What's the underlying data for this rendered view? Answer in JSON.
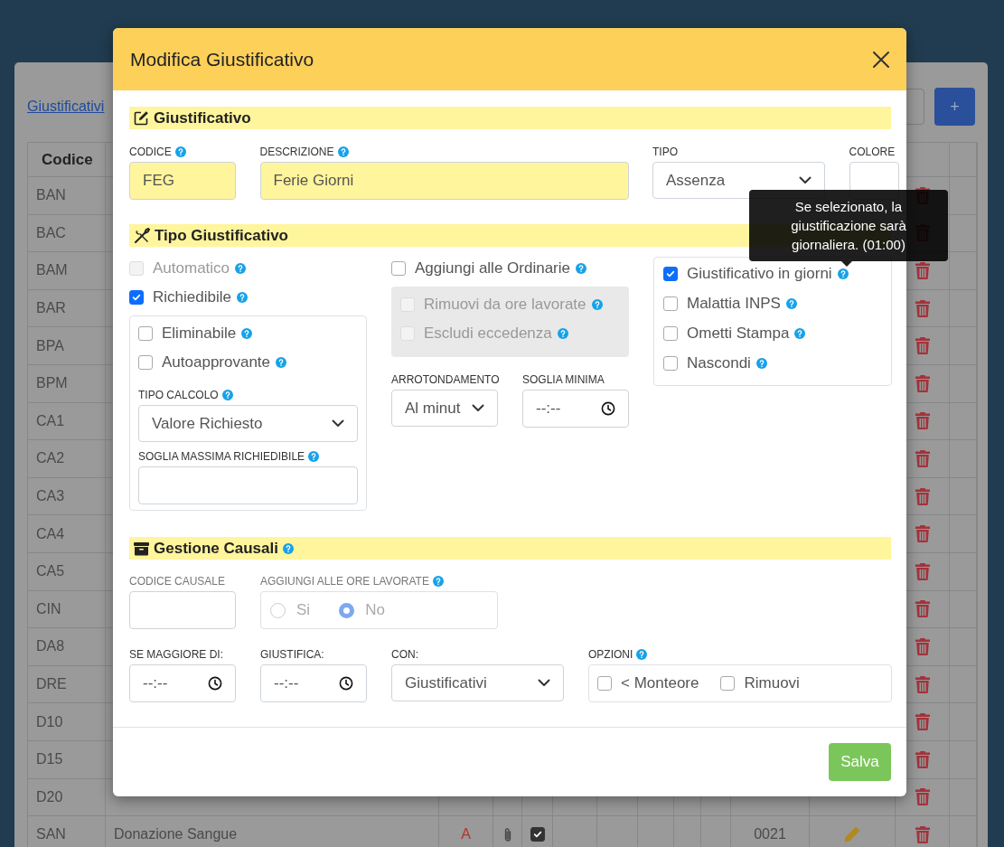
{
  "background": {
    "link": "Giustificativi",
    "add_button": "+",
    "table": {
      "header": "Codice",
      "rows": [
        {
          "code": "BAN"
        },
        {
          "code": "BAC"
        },
        {
          "code": "BAM"
        },
        {
          "code": "BAR"
        },
        {
          "code": "BPA"
        },
        {
          "code": "BPM"
        },
        {
          "code": "CA1"
        },
        {
          "code": "CA2"
        },
        {
          "code": "CA3"
        },
        {
          "code": "CA4"
        },
        {
          "code": "CA5"
        },
        {
          "code": "CIN"
        },
        {
          "code": "DA8"
        },
        {
          "code": "DRE"
        },
        {
          "code": "D10"
        },
        {
          "code": "D15"
        },
        {
          "code": "D20"
        },
        {
          "code": "SAN",
          "description": "Donazione Sangue",
          "flag": "A",
          "color": "#b0352f",
          "attachment": true,
          "checked": true,
          "number": "0021"
        }
      ]
    }
  },
  "modal": {
    "title": "Modifica Giustificativo",
    "giustificativo": {
      "heading": "Giustificativo",
      "codice": {
        "label": "CODICE",
        "help": true,
        "value": "FEG"
      },
      "descrizione": {
        "label": "DESCRIZIONE",
        "help": true,
        "value": "Ferie Giorni"
      },
      "tipo": {
        "label": "TIPO",
        "value": "Assenza"
      },
      "colore": {
        "label": "COLORE"
      }
    },
    "tipo_giustificativo": {
      "heading": "Tipo Giustificativo",
      "col1_top": [
        {
          "label": "Automatico",
          "checked": false,
          "disabled": true,
          "help": true
        },
        {
          "label": "Richiedibile",
          "checked": true,
          "disabled": false,
          "help": true
        }
      ],
      "col1_box": [
        {
          "label": "Eliminabile",
          "checked": false,
          "disabled": false,
          "help": true
        },
        {
          "label": "Autoapprovante",
          "checked": false,
          "disabled": false,
          "help": true
        }
      ],
      "tipo_calcolo": {
        "label": "TIPO CALCOLO",
        "help": true,
        "value": "Valore Richiesto"
      },
      "soglia_massima": {
        "label": "SOGLIA MASSIMA RICHIEDIBILE",
        "help": true
      },
      "col2_top": [
        {
          "label": "Aggiungi alle Ordinarie",
          "checked": false,
          "disabled": false,
          "help": true
        }
      ],
      "col2_box": [
        {
          "label": "Rimuovi da ore lavorate",
          "checked": false,
          "disabled": true,
          "help": true
        },
        {
          "label": "Escludi eccedenza",
          "checked": false,
          "disabled": true,
          "help": true
        }
      ],
      "arrotondamento": {
        "label": "ARROTONDAMENTO",
        "value": "Al minut"
      },
      "soglia_minima": {
        "label": "SOGLIA MINIMA",
        "value": "--:--"
      },
      "col3_box": [
        {
          "label": "Giustificativo in giorni",
          "checked": true,
          "disabled": false,
          "help": true
        },
        {
          "label": "Malattia INPS",
          "checked": false,
          "disabled": false,
          "help": true
        },
        {
          "label": "Ometti Stampa",
          "checked": false,
          "disabled": false,
          "help": true
        },
        {
          "label": "Nascondi",
          "checked": false,
          "disabled": false,
          "help": true
        }
      ]
    },
    "tooltip": "Se selezionato, la giustificazione sarà giornaliera. (01:00)",
    "gestione_causali": {
      "heading": "Gestione Causali",
      "help": true,
      "codice_causale": {
        "label": "CODICE CAUSALE",
        "disabled": true
      },
      "aggiungi_ore": {
        "label": "AGGIUNGI ALLE ORE LAVORATE",
        "help": true,
        "disabled": true,
        "options": [
          {
            "label": "Si",
            "selected": false
          },
          {
            "label": "No",
            "selected": true
          }
        ]
      },
      "se_maggiore": {
        "label": "SE MAGGIORE DI:",
        "value": "--:--"
      },
      "giustifica": {
        "label": "GIUSTIFICA:",
        "value": "--:--"
      },
      "con": {
        "label": "CON:",
        "value": "Giustificativi"
      },
      "opzioni": {
        "label": "OPZIONI",
        "help": true,
        "items": [
          {
            "label": "< Monteore",
            "checked": false
          },
          {
            "label": "Rimuovi",
            "checked": false
          }
        ]
      }
    },
    "save_button": "Salva"
  }
}
